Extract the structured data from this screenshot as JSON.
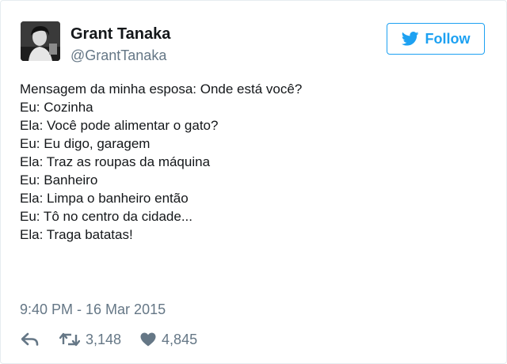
{
  "user": {
    "name": "Grant Tanaka",
    "handle": "@GrantTanaka",
    "avatar_icon": "profile-photo"
  },
  "follow_button": {
    "label": "Follow",
    "icon": "bird-icon",
    "color": "#1da1f2"
  },
  "tweet": {
    "lines": [
      "Mensagem da minha esposa: Onde está você?",
      "Eu: Cozinha",
      "Ela: Você pode alimentar o gato?",
      "Eu: Eu digo, garagem",
      "Ela: Traz as roupas da máquina",
      "Eu: Banheiro",
      "Ela: Limpa o banheiro então",
      "Eu: Tô no centro da cidade...",
      "Ela: Traga batatas!"
    ],
    "timestamp": "9:40 PM - 16 Mar 2015"
  },
  "actions": {
    "reply_icon": "reply-icon",
    "retweet_icon": "retweet-icon",
    "retweet_count": "3,148",
    "like_icon": "heart-icon",
    "like_count": "4,845"
  },
  "colors": {
    "accent": "#1da1f2",
    "text": "#14171a",
    "muted": "#657786"
  }
}
